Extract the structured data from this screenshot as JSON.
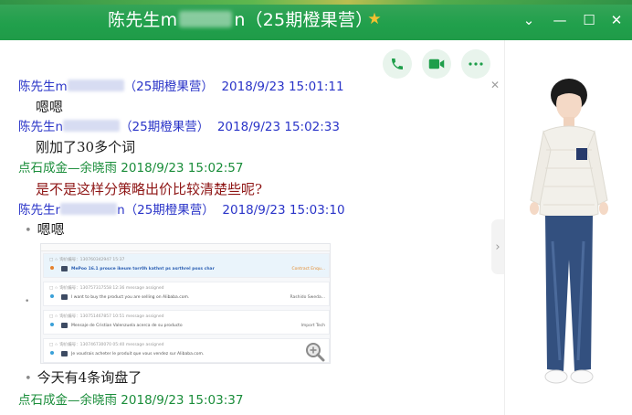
{
  "window": {
    "title_prefix": "陈先生m",
    "title_suffix": "n（25期橙果营）",
    "controls": [
      "chevron-down-icon",
      "minimize-icon",
      "maximize-icon",
      "close-icon"
    ]
  },
  "actions": {
    "voice_call": "phone-icon",
    "video_call": "video-camera-icon",
    "more": "more-icon"
  },
  "messages": [
    {
      "sender_prefix": "陈先生m",
      "sender_suffix": "（25期橙果营）",
      "time": "2018/9/23 15:01:11",
      "text": "嗯嗯",
      "color": "#2a34c8"
    },
    {
      "sender_prefix": "陈先生n",
      "sender_suffix": "（25期橙果营）",
      "time": "2018/9/23 15:02:33",
      "text": "刚加了30多个词",
      "color": "#2a34c8"
    },
    {
      "sender": "点石成金—余晓雨",
      "time": "2018/9/23 15:02:57",
      "text": "是不是这样分策略出价比较清楚些呢?",
      "color": "#1a8d3a"
    },
    {
      "sender_prefix": "陈先生r",
      "sender_suffix": "n（25期橙果营）",
      "time": "2018/9/23 15:03:10",
      "lines": [
        "嗯嗯",
        "今天有4条询盘了"
      ],
      "color": "#2a34c8"
    },
    {
      "sender": "点石成金—余晓雨",
      "time": "2018/9/23 15:03:37",
      "color": "#1a8d3a"
    }
  ],
  "screenshot_rows": [
    {
      "meta": "□ ☆ 询价编号：130760342947   15:37",
      "subject": "MePoo 16.1 prouce ikeum torr0h kathnt ps asrthrel poxs char",
      "tag": "Contract Enqu...",
      "highlight": true
    },
    {
      "meta": "□ ☆ 询价编号：130757317558   12:36   message assigned",
      "subject": "I want to buy the product you are selling on Alibaba.com.",
      "tag": "Rashido Sweda...",
      "highlight": false
    },
    {
      "meta": "□ ☆ 询价编号：130751467857   10:51   message assigned",
      "subject": "Mensaje de Cristian Valenzuela acerca de su producto",
      "tag": "Import Tech",
      "highlight": false
    },
    {
      "meta": "□ ☆ 询价编号：130746730070   05:40   message assigned",
      "subject": "Je voudrais acheter le produit que vous vendez sur Alibaba.com.",
      "tag": "",
      "highlight": false
    }
  ],
  "colors": {
    "titlebar": "#21a04c",
    "sender_blue": "#2a34c8",
    "sender_green": "#1a8d3a",
    "highlight_text": "#8e1515",
    "star": "#f4c130"
  }
}
